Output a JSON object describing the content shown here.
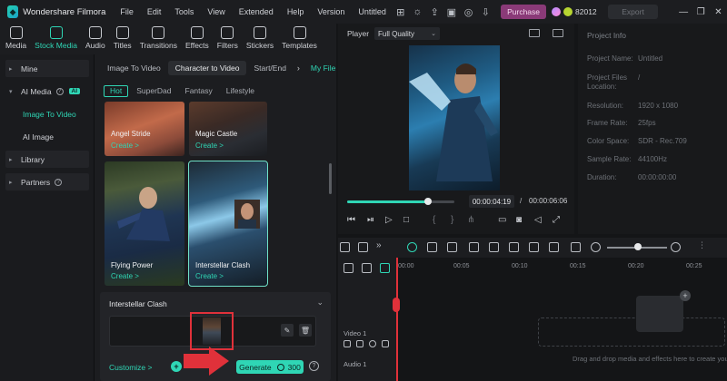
{
  "app": {
    "name": "Wondershare Filmora"
  },
  "menu": [
    "File",
    "Edit",
    "Tools",
    "View",
    "Extended",
    "Help",
    "Version",
    "Untitled"
  ],
  "titlebar": {
    "purchase_label": "Purchase",
    "credits": "82012",
    "export_label": "Export"
  },
  "toolbar": [
    {
      "label": "Media"
    },
    {
      "label": "Stock Media"
    },
    {
      "label": "Audio"
    },
    {
      "label": "Titles"
    },
    {
      "label": "Transitions"
    },
    {
      "label": "Effects"
    },
    {
      "label": "Filters"
    },
    {
      "label": "Stickers"
    },
    {
      "label": "Templates"
    }
  ],
  "sidebar": {
    "mine": "Mine",
    "ai_media": "AI Media",
    "ai_badge": "AI",
    "image_to_video": "Image To Video",
    "ai_image": "AI Image",
    "library": "Library",
    "partners": "Partners"
  },
  "library": {
    "tabs": [
      "Image To Video",
      "Character to Video",
      "Start/End"
    ],
    "my_file": "My File",
    "chips": [
      "Hot",
      "SuperDad",
      "Fantasy",
      "Lifestyle"
    ],
    "cards": [
      {
        "title": "Angel Stride",
        "create": "Create >"
      },
      {
        "title": "Magic Castle",
        "create": "Create >"
      },
      {
        "title": "Flying Power",
        "create": "Create >"
      },
      {
        "title": "Interstellar Clash",
        "create": "Create >"
      }
    ],
    "config": {
      "name": "Interstellar Clash",
      "customize": "Customize >",
      "generate": "Generate",
      "cost": "300"
    }
  },
  "player": {
    "label": "Player",
    "quality": "Full Quality",
    "current_time": "00:00:04:19",
    "separator": "/",
    "total_time": "00:00:06:06",
    "progress": 0.75
  },
  "project_info": {
    "title": "Project Info",
    "rows": [
      {
        "label": "Project Name:",
        "value": "Untitled"
      },
      {
        "label": "Project Files Location:",
        "value": "/"
      },
      {
        "label": "Resolution:",
        "value": "1920 x 1080"
      },
      {
        "label": "Frame Rate:",
        "value": "25fps"
      },
      {
        "label": "Color Space:",
        "value": "SDR - Rec.709"
      },
      {
        "label": "Sample Rate:",
        "value": "44100Hz"
      },
      {
        "label": "Duration:",
        "value": "00:00:00:00"
      }
    ]
  },
  "timeline": {
    "ruler": [
      "00:00",
      "00:05",
      "00:10",
      "00:15",
      "00:20",
      "00:25"
    ],
    "video_track": "Video 1",
    "audio_track": "Audio 1",
    "drag_hint": "Drag and drop media and effects here to create your video."
  },
  "colors": {
    "accent": "#2fd6b5",
    "highlight": "#e0313a",
    "purchase": "#8a3a78"
  }
}
